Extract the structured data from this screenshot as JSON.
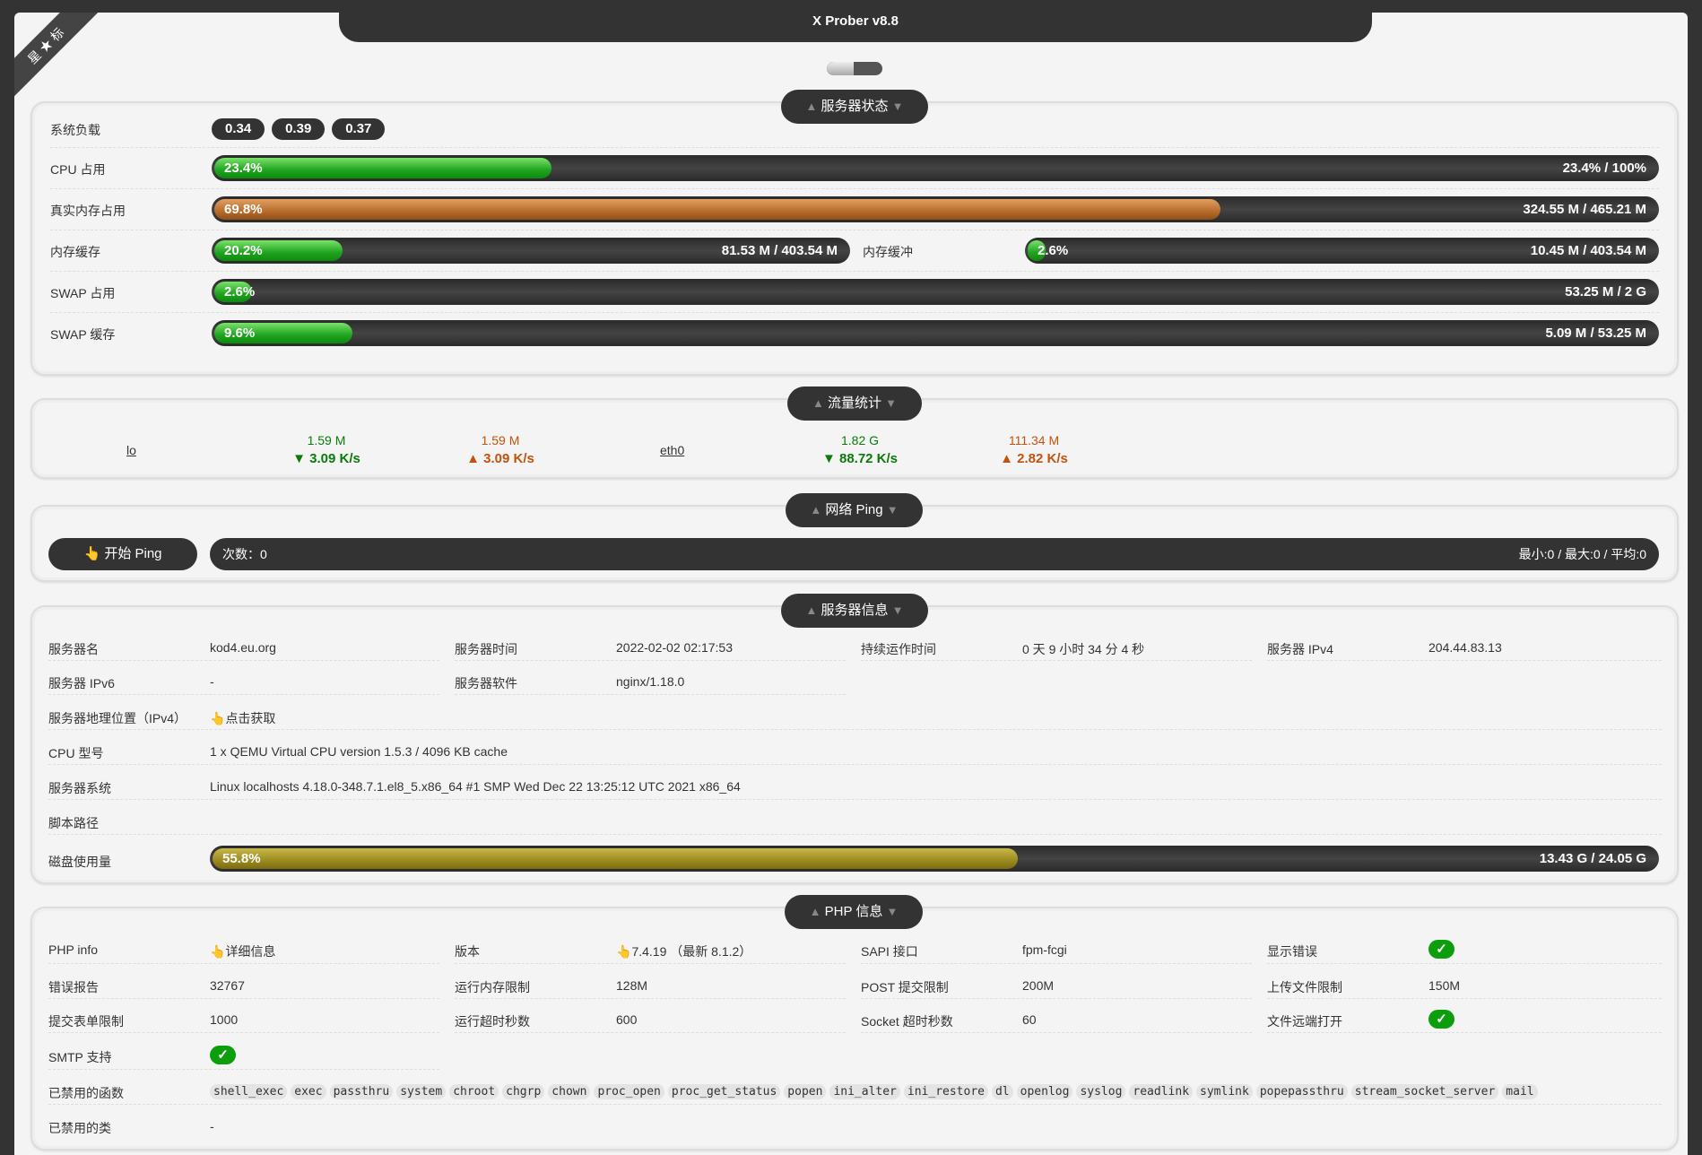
{
  "app": {
    "title": "X Prober v8.8",
    "ribbon": "星 ★ 标"
  },
  "server_status": {
    "legend": "服务器状态",
    "load_label": "系统负载",
    "load": [
      "0.34",
      "0.39",
      "0.37"
    ],
    "cpu": {
      "label": "CPU 占用",
      "pct": "23.4%",
      "total": "23.4% / 100%",
      "value": 0.234
    },
    "real_mem": {
      "label": "真实内存占用",
      "pct": "69.8%",
      "total": "324.55 M / 465.21 M",
      "value": 0.698
    },
    "mem_cache": {
      "label": "内存缓存",
      "pct": "20.2%",
      "total": "81.53 M / 403.54 M",
      "value": 0.202
    },
    "mem_buffer": {
      "label": "内存缓冲",
      "pct": "2.6%",
      "total": "10.45 M / 403.54 M",
      "value": 0.026
    },
    "swap": {
      "label": "SWAP 占用",
      "pct": "2.6%",
      "total": "53.25 M / 2 G",
      "value": 0.026
    },
    "swap_cache": {
      "label": "SWAP 缓存",
      "pct": "9.6%",
      "total": "5.09 M / 53.25 M",
      "value": 0.096
    }
  },
  "network": {
    "legend": "流量统计",
    "interfaces": [
      {
        "name": "lo",
        "rx_total": "1.59 M",
        "rx_speed": "▼ 3.09 K/s",
        "tx_total": "1.59 M",
        "tx_speed": "▲ 3.09 K/s"
      },
      {
        "name": "eth0",
        "rx_total": "1.82 G",
        "rx_speed": "▼ 88.72 K/s",
        "tx_total": "111.34 M",
        "tx_speed": "▲ 2.82 K/s"
      }
    ]
  },
  "ping": {
    "legend": "网络 Ping",
    "button": "开始 Ping",
    "count": "次数：0",
    "stats": "最小:0 / 最大:0 / 平均:0"
  },
  "server_info": {
    "legend": "服务器信息",
    "name_label": "服务器名",
    "name": "kod4.eu.org",
    "time_label": "服务器时间",
    "time": "2022-02-02 02:17:53",
    "uptime_label": "持续运作时间",
    "uptime": "0 天 9 小时 34 分 4 秒",
    "ipv4_label": "服务器 IPv4",
    "ipv4": "204.44.83.13",
    "ipv6_label": "服务器 IPv6",
    "ipv6": "-",
    "software_label": "服务器软件",
    "software": "nginx/1.18.0",
    "geo_label": "服务器地理位置（IPv4）",
    "geo": "点击获取",
    "cpu_model_label": "CPU 型号",
    "cpu_model": "1 x QEMU Virtual CPU version 1.5.3 / 4096 KB cache",
    "os_label": "服务器系统",
    "os": "Linux localhosts 4.18.0-348.7.1.el8_5.x86_64 #1 SMP Wed Dec 22 13:25:12 UTC 2021 x86_64",
    "path_label": "脚本路径",
    "path": "",
    "disk_label": "磁盘使用量",
    "disk_pct": "55.8%",
    "disk_total": "13.43 G / 24.05 G",
    "disk_value": 0.558
  },
  "php": {
    "legend": "PHP 信息",
    "info_label": "PHP info",
    "info": "详细信息",
    "version_label": "版本",
    "version": "7.4.19 （最新 8.1.2）",
    "sapi_label": "SAPI 接口",
    "sapi": "fpm-fcgi",
    "display_errors_label": "显示错误",
    "error_reporting_label": "错误报告",
    "error_reporting": "32767",
    "memory_limit_label": "运行内存限制",
    "memory_limit": "128M",
    "post_max_label": "POST 提交限制",
    "post_max": "200M",
    "upload_max_label": "上传文件限制",
    "upload_max": "150M",
    "max_input_label": "提交表单限制",
    "max_input": "1000",
    "max_exec_label": "运行超时秒数",
    "max_exec": "600",
    "socket_timeout_label": "Socket 超时秒数",
    "socket_timeout": "60",
    "url_fopen_label": "文件远端打开",
    "smtp_label": "SMTP 支持",
    "disabled_functions_label": "已禁用的函数",
    "disabled_functions": [
      "shell_exec",
      "exec",
      "passthru",
      "system",
      "chroot",
      "chgrp",
      "chown",
      "proc_open",
      "proc_get_status",
      "popen",
      "ini_alter",
      "ini_restore",
      "dl",
      "openlog",
      "syslog",
      "readlink",
      "symlink",
      "popepassthru",
      "stream_socket_server",
      "mail"
    ],
    "disabled_classes_label": "已禁用的类",
    "disabled_classes": "-"
  },
  "colors": {
    "accent_green": "#1fa31f",
    "mem_brown": "#b86b2b",
    "disk_olive": "#9b8a1e",
    "dark": "#333333"
  }
}
